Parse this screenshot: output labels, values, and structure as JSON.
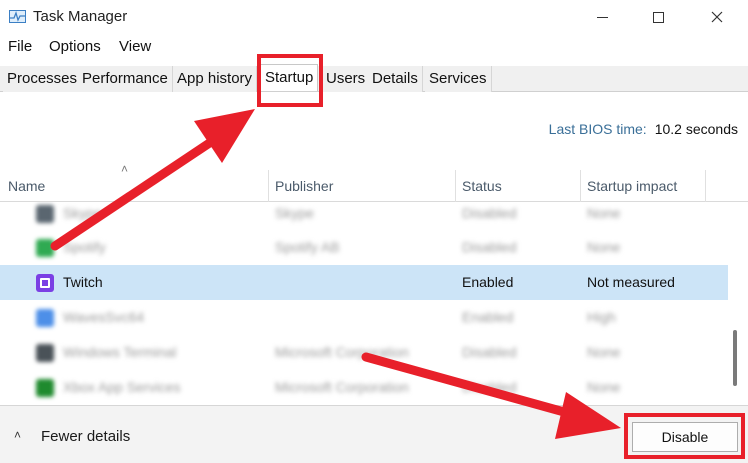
{
  "window": {
    "title": "Task Manager",
    "icon": "task-manager-icon"
  },
  "menu": [
    "File",
    "Options",
    "View"
  ],
  "tabs": [
    "Processes",
    "Performance",
    "App history",
    "Startup",
    "Users",
    "Details",
    "Services"
  ],
  "active_tab": "Startup",
  "bios": {
    "label": "Last BIOS time:",
    "value": "10.2 seconds"
  },
  "columns": {
    "name": "Name",
    "publisher": "Publisher",
    "status": "Status",
    "impact": "Startup impact"
  },
  "rows": [
    {
      "name": "Skype",
      "publisher": "Skype",
      "status": "Disabled",
      "impact": "None",
      "icon": "skype-icon",
      "color": "#5a6670"
    },
    {
      "name": "Spotify",
      "publisher": "Spotify AB",
      "status": "Disabled",
      "impact": "None",
      "icon": "spotify-icon",
      "color": "#2faa52"
    },
    {
      "name": "Twitch",
      "publisher": "",
      "status": "Enabled",
      "impact": "Not measured",
      "icon": "twitch-icon",
      "color": "#7b3fe4"
    },
    {
      "name": "WavesSvc64",
      "publisher": "",
      "status": "Enabled",
      "impact": "High",
      "icon": "waves-icon",
      "color": "#4d8fe8"
    },
    {
      "name": "Windows Terminal",
      "publisher": "Microsoft Corporation",
      "status": "Disabled",
      "impact": "None",
      "icon": "terminal-icon",
      "color": "#4a5258"
    },
    {
      "name": "Xbox App Services",
      "publisher": "Microsoft Corporation",
      "status": "Disabled",
      "impact": "None",
      "icon": "xbox-icon",
      "color": "#1f8a2e"
    }
  ],
  "footer": {
    "fewer_details": "Fewer details",
    "disable": "Disable"
  },
  "colors": {
    "selection": "#cce4f7",
    "highlight": "#e8202a",
    "bios_label": "#3a6f98"
  }
}
